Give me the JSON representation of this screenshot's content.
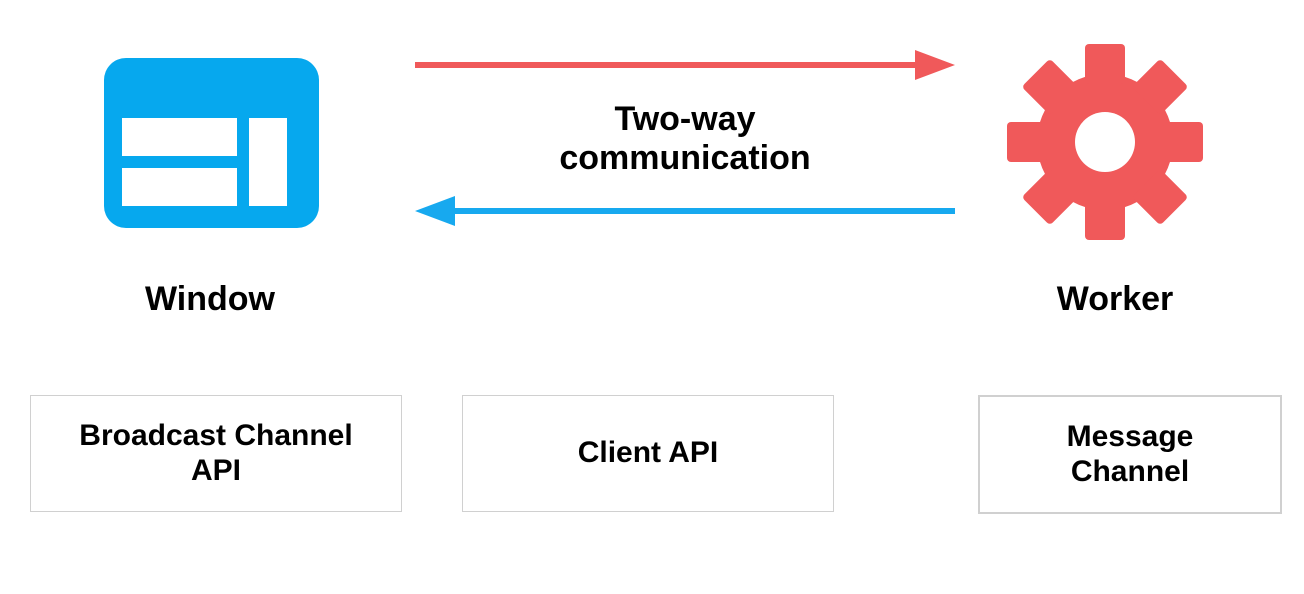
{
  "diagram": {
    "title": "Two-way communication between Window and Worker",
    "left_entity": {
      "label": "Window"
    },
    "right_entity": {
      "label": "Worker"
    },
    "communication_label_line1": "Two-way",
    "communication_label_line2": "communication",
    "arrows": {
      "top": {
        "direction": "right",
        "from": "Window",
        "to": "Worker",
        "color": "#f0595a"
      },
      "bottom": {
        "direction": "left",
        "from": "Worker",
        "to": "Window",
        "color": "#17a9ef"
      }
    },
    "api_boxes": {
      "broadcast": {
        "label_line1": "Broadcast Channel",
        "label_line2": "API"
      },
      "client": {
        "label": "Client API"
      },
      "message": {
        "label_line1": "Message",
        "label_line2": "Channel"
      }
    },
    "colors": {
      "window_icon": "#06a8ee",
      "gear_icon": "#f0595a",
      "arrow_red": "#f0595a",
      "arrow_blue": "#17a9ef",
      "box_border": "#d0d0d0"
    }
  }
}
